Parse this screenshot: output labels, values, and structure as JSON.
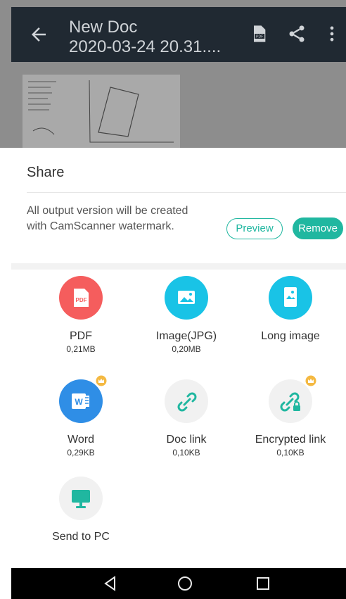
{
  "appbar": {
    "title_line1": "New Doc",
    "title_line2": "2020-03-24 20.31....",
    "icons": [
      "back-arrow-icon",
      "pdf-icon",
      "share-icon",
      "more-vertical-icon"
    ]
  },
  "sheet": {
    "title": "Share",
    "watermark_notice": "All output version will be created with CamScanner watermark.",
    "preview_button": "Preview",
    "remove_button": "Remove"
  },
  "options": [
    {
      "label": "PDF",
      "size": "0,21MB",
      "icon": "pdf-icon",
      "color": "#f55d5d"
    },
    {
      "label": "Image(JPG)",
      "size": "0,20MB",
      "icon": "image-icon",
      "color": "#19c3e6"
    },
    {
      "label": "Long image",
      "size": "",
      "icon": "long-image-icon",
      "color": "#19c3e6"
    },
    {
      "label": "Word",
      "size": "0,29KB",
      "icon": "word-icon",
      "color": "#2f8ee6"
    },
    {
      "label": "Doc link",
      "size": "0,10KB",
      "icon": "link-icon",
      "color": "#f1f1f1"
    },
    {
      "label": "Encrypted link",
      "size": "0,10KB",
      "icon": "encrypted-link-icon",
      "color": "#f1f1f1"
    },
    {
      "label": "Send to PC",
      "size": "",
      "icon": "monitor-icon",
      "color": "#f1f1f1"
    }
  ],
  "navbar": {
    "icons": [
      "back-triangle-icon",
      "home-circle-icon",
      "recents-square-icon"
    ]
  }
}
